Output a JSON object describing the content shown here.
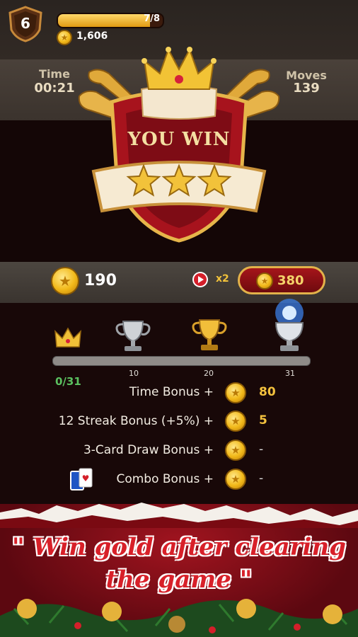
{
  "header": {
    "level": "6",
    "xp_text": "7/8",
    "xp_progress": 0.875,
    "coins": "1,606"
  },
  "stats": {
    "time_label": "Time",
    "time_value": "00:21",
    "moves_label": "Moves",
    "moves_value": "139"
  },
  "result": {
    "title": "YOU WIN",
    "stars": 3
  },
  "reward": {
    "amount": "190",
    "multiplier": "x2",
    "doubled_amount": "380"
  },
  "trophy_progress": {
    "current": "0/31",
    "value": 0,
    "max": 31,
    "milestones": [
      {
        "icon": "crown-icon",
        "label": ""
      },
      {
        "icon": "silver-trophy-icon",
        "label": "10"
      },
      {
        "icon": "gold-trophy-icon",
        "label": "20"
      },
      {
        "icon": "diamond-trophy-icon",
        "label": "31"
      }
    ]
  },
  "bonuses": [
    {
      "label": "Time Bonus +",
      "value": "80"
    },
    {
      "label": "12 Streak Bonus (+5%) +",
      "value": "5"
    },
    {
      "label": "3-Card Draw Bonus +",
      "value": "-"
    },
    {
      "label": "Combo Bonus +",
      "value": "-"
    }
  ],
  "promo": {
    "line1": "\" Win gold after clearing",
    "line2": "the game \""
  },
  "colors": {
    "gold": "#f4c23e",
    "red": "#a5151a",
    "green": "#5bc160"
  }
}
